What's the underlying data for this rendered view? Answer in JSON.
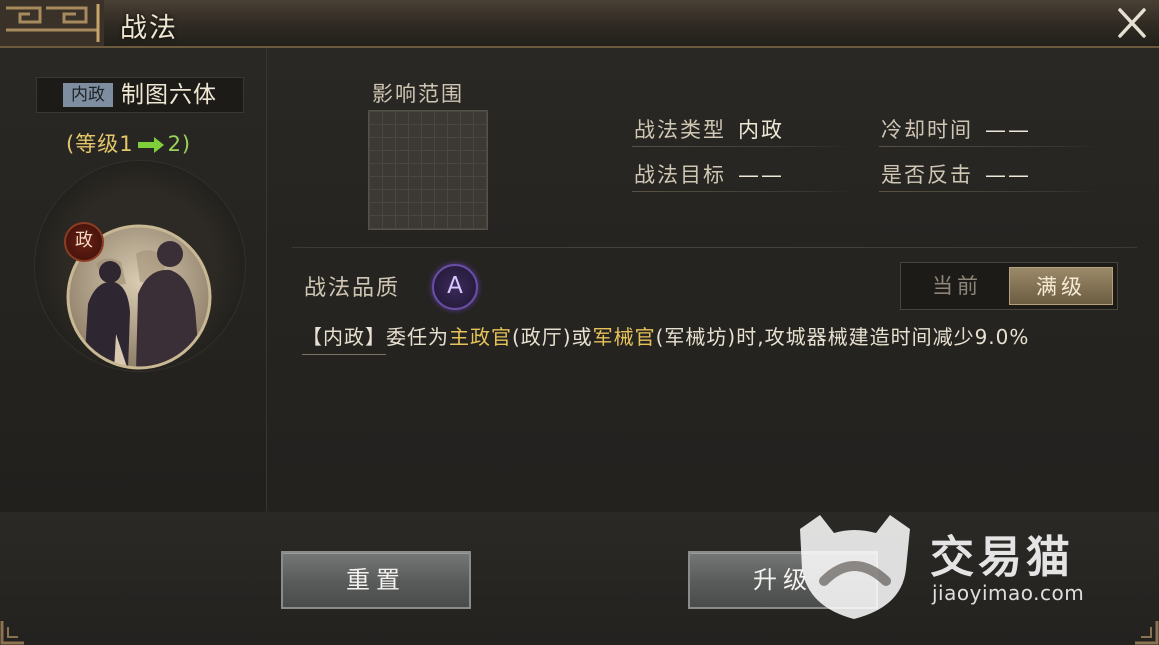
{
  "window": {
    "title": "战法"
  },
  "skill": {
    "tag": "内政",
    "name": "制图六体",
    "level_prefix": "(等级1",
    "level_suffix": "2)",
    "portrait_badge": "政"
  },
  "scope": {
    "label": "影响范围"
  },
  "info": {
    "type_key": "战法类型",
    "type_val": "内政",
    "target_key": "战法目标",
    "target_val": "——",
    "cooldown_key": "冷却时间",
    "cooldown_val": "——",
    "counter_key": "是否反击",
    "counter_val": "——"
  },
  "quality": {
    "label": "战法品质",
    "grade": "A"
  },
  "toggle": {
    "current": "当前",
    "max": "满级",
    "selected": "max"
  },
  "description": {
    "bracket": "【内政】",
    "p1": "委任为",
    "hl1": "主政官",
    "p2": "(政厅)或",
    "hl2": "军械官",
    "p3": "(军械坊)时,攻城器械建造时间减少9.0%"
  },
  "buttons": {
    "reset": "重置",
    "upgrade": "升级"
  },
  "watermark": {
    "brand": "交易猫",
    "url": "jiaoyimao.com"
  },
  "colors": {
    "gold": "#e6c25a",
    "green": "#9ad35c",
    "accent_purple": "#6a4ea8"
  }
}
